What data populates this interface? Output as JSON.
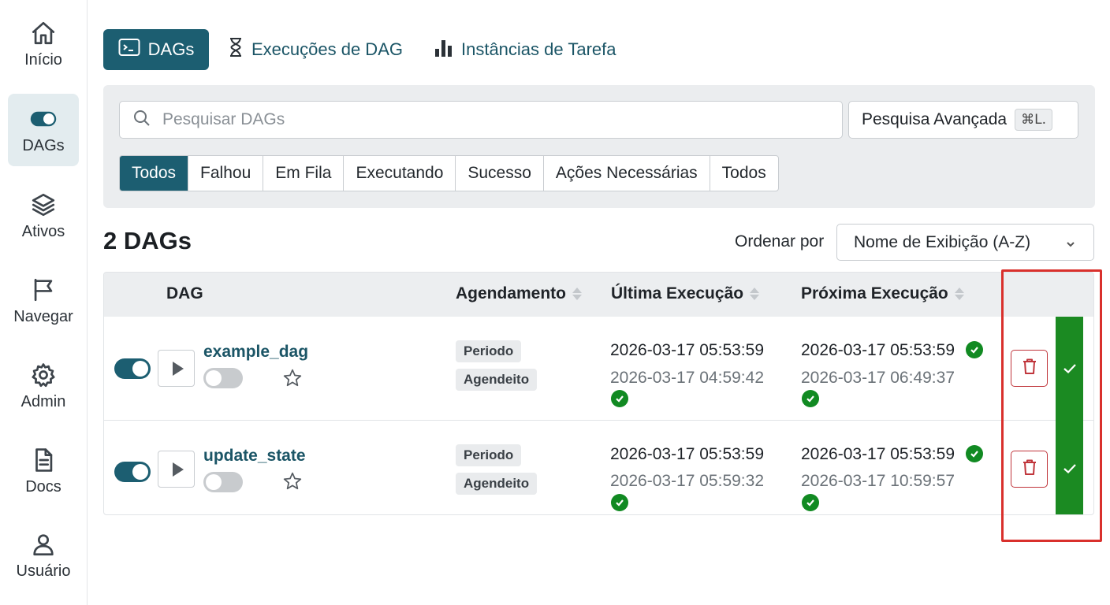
{
  "sidebar": {
    "items": [
      {
        "label": "Início",
        "icon": "home-icon"
      },
      {
        "label": "DAGs",
        "icon": "toggle-icon",
        "active": true
      },
      {
        "label": "Ativos",
        "icon": "layers-icon"
      },
      {
        "label": "Navegar",
        "icon": "flag-icon"
      },
      {
        "label": "Admin",
        "icon": "gear-icon"
      },
      {
        "label": "Docs",
        "icon": "document-icon"
      },
      {
        "label": "Usuário",
        "icon": "user-icon"
      }
    ]
  },
  "topnav": {
    "dags": "DAGs",
    "runs": "Execuções de DAG",
    "tasks": "Instâncias de Tarefa"
  },
  "search": {
    "placeholder": "Pesquisar DAGs",
    "advanced_label": "Pesquisa Avançada",
    "shortcut": "⌘L."
  },
  "filters": [
    "Todos",
    "Falhou",
    "Em Fila",
    "Executando",
    "Sucesso",
    "Ações Necessárias",
    "Todos"
  ],
  "summary": {
    "count_label": "2 DAGs",
    "sort_label": "Ordenar por",
    "sort_value": "Nome de Exibição (A-Z)"
  },
  "table": {
    "headers": {
      "dag": "DAG",
      "schedule": "Agendamento",
      "last_run": "Última Execução",
      "next_run": "Próxima Execução"
    },
    "rows": [
      {
        "name": "example_dag",
        "badges": [
          "Periodo",
          "Agendeito"
        ],
        "last_run": "2026-03-17 05:53:59",
        "last_run_sub": "2026-03-17 04:59:42",
        "next_run": "2026-03-17 05:53:59",
        "next_run_sub": "2026-03-17 06:49:37"
      },
      {
        "name": "update_state",
        "badges": [
          "Periodo",
          "Agendeito"
        ],
        "last_run": "2026-03-17 05:53:59",
        "last_run_sub": "2026-03-17 05:59:32",
        "next_run": "2026-03-17 05:53:59",
        "next_run_sub": "2026-03-17 10:59:57"
      }
    ]
  },
  "colors": {
    "primary": "#1c5e71",
    "success": "#118a22",
    "danger": "#c0353b",
    "highlight": "#d9302c"
  }
}
